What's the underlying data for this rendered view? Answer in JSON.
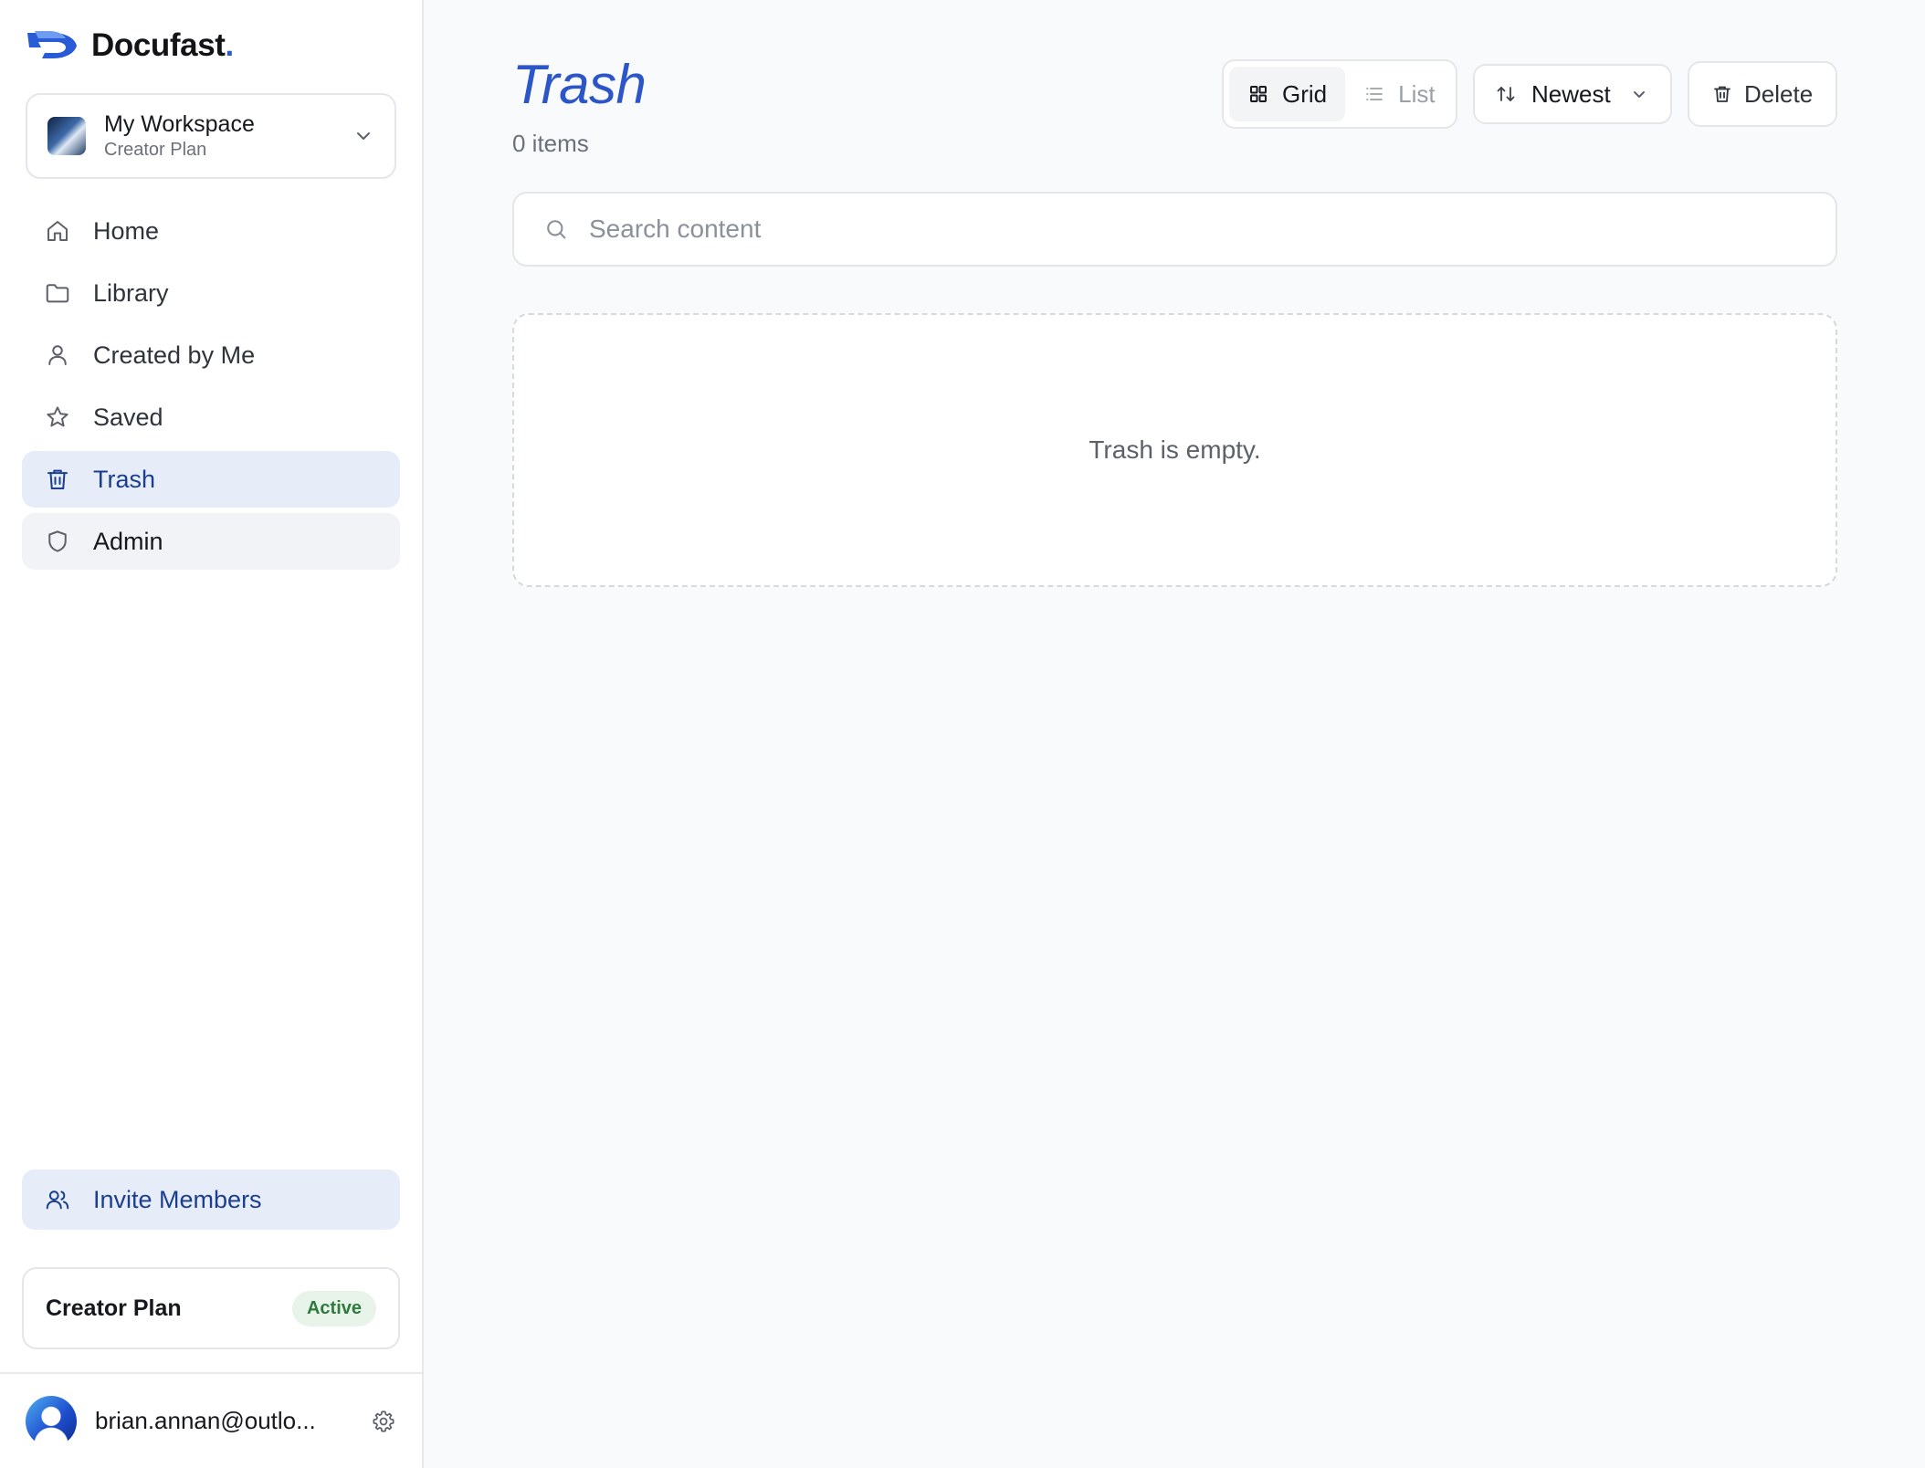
{
  "brand": {
    "name": "Docufast",
    "dot": "."
  },
  "workspace": {
    "name": "My Workspace",
    "plan": "Creator Plan"
  },
  "nav": {
    "items": [
      {
        "label": "Home",
        "icon": "home-icon"
      },
      {
        "label": "Library",
        "icon": "folder-icon"
      },
      {
        "label": "Created by Me",
        "icon": "user-icon"
      },
      {
        "label": "Saved",
        "icon": "star-icon"
      },
      {
        "label": "Trash",
        "icon": "trash-icon",
        "active": true
      },
      {
        "label": "Admin",
        "icon": "shield-icon"
      }
    ]
  },
  "invite": {
    "label": "Invite Members"
  },
  "plan_card": {
    "name": "Creator Plan",
    "status": "Active"
  },
  "user": {
    "email": "brian.annan@outlo..."
  },
  "main": {
    "title": "Trash",
    "count": "0 items",
    "view_toggle": {
      "grid": "Grid",
      "list": "List",
      "selected": "Grid"
    },
    "sort": {
      "label": "Newest"
    },
    "delete_label": "Delete",
    "search": {
      "placeholder": "Search content",
      "value": ""
    },
    "empty_message": "Trash is empty."
  },
  "colors": {
    "accent": "#2b55c8",
    "active_nav_bg": "#e6ecf8",
    "badge_bg": "#e8f3ea",
    "badge_text": "#2f7a3e"
  }
}
